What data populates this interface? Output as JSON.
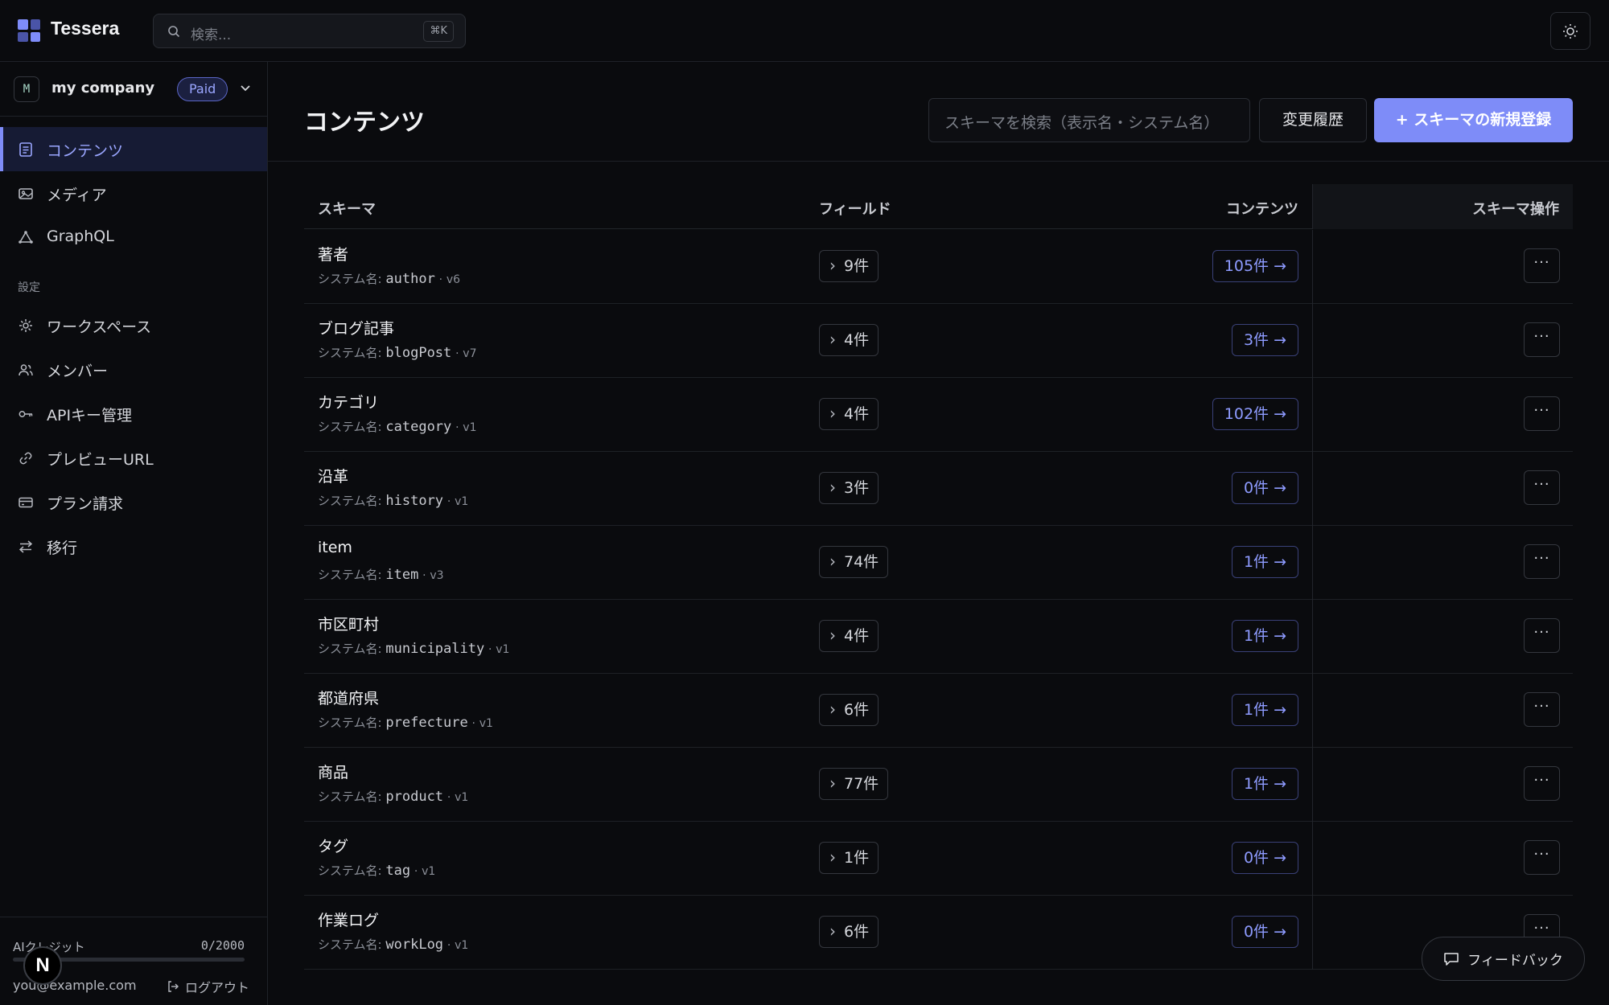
{
  "app": {
    "name": "Tessera"
  },
  "search": {
    "placeholder": "検索...",
    "shortcut": "⌘K"
  },
  "workspace": {
    "avatar": "M",
    "name": "my company",
    "plan": "Paid"
  },
  "nav": {
    "main": [
      {
        "label": "コンテンツ",
        "icon": "document-icon",
        "active": true
      },
      {
        "label": "メディア",
        "icon": "image-icon"
      },
      {
        "label": "GraphQL",
        "icon": "graphql-icon"
      }
    ],
    "settings_label": "設定",
    "settings": [
      {
        "label": "ワークスペース",
        "icon": "gear-icon"
      },
      {
        "label": "メンバー",
        "icon": "users-icon"
      },
      {
        "label": "APIキー管理",
        "icon": "key-icon"
      },
      {
        "label": "プレビューURL",
        "icon": "link-icon"
      },
      {
        "label": "プラン請求",
        "icon": "credit-card-icon"
      },
      {
        "label": "移行",
        "icon": "arrows-swap-icon"
      }
    ]
  },
  "footer": {
    "credit_label": "AIクレジット",
    "credit_value": "0/2000",
    "credit_used_fraction": 0,
    "email": "you@example.com",
    "logout": "ログアウト",
    "n_badge": "N"
  },
  "page": {
    "title": "コンテンツ",
    "schema_search_placeholder": "スキーマを検索（表示名・システム名）",
    "history_button": "変更履歴",
    "new_button": "+ スキーマの新規登録"
  },
  "table": {
    "headers": {
      "schema": "スキーマ",
      "fields": "フィールド",
      "contents": "コンテンツ",
      "ops": "スキーマ操作"
    },
    "sys_prefix": "システム名:",
    "rows": [
      {
        "name": "著者",
        "sys": "author",
        "ver": "v6",
        "fields": "9件",
        "contents": "105件 →"
      },
      {
        "name": "ブログ記事",
        "sys": "blogPost",
        "ver": "v7",
        "fields": "4件",
        "contents": "3件 →"
      },
      {
        "name": "カテゴリ",
        "sys": "category",
        "ver": "v1",
        "fields": "4件",
        "contents": "102件 →"
      },
      {
        "name": "沿革",
        "sys": "history",
        "ver": "v1",
        "fields": "3件",
        "contents": "0件 →"
      },
      {
        "name": "item",
        "sys": "item",
        "ver": "v3",
        "fields": "74件",
        "contents": "1件 →"
      },
      {
        "name": "市区町村",
        "sys": "municipality",
        "ver": "v1",
        "fields": "4件",
        "contents": "1件 →"
      },
      {
        "name": "都道府県",
        "sys": "prefecture",
        "ver": "v1",
        "fields": "6件",
        "contents": "1件 →"
      },
      {
        "name": "商品",
        "sys": "product",
        "ver": "v1",
        "fields": "77件",
        "contents": "1件 →"
      },
      {
        "name": "タグ",
        "sys": "tag",
        "ver": "v1",
        "fields": "1件",
        "contents": "0件 →"
      },
      {
        "name": "作業ログ",
        "sys": "workLog",
        "ver": "v1",
        "fields": "6件",
        "contents": "0件 →"
      }
    ]
  },
  "feedback": {
    "label": "フィードバック"
  },
  "colors": {
    "accent": "#7e8cf8",
    "background": "#0a0b0e"
  }
}
